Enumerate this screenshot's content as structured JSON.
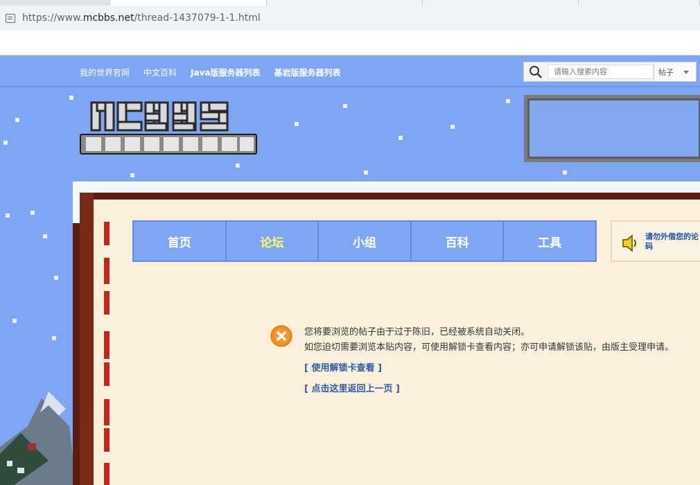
{
  "browser": {
    "url_prefix": "https://www.",
    "url_host": "mcbbs.net",
    "url_path": "/thread-1437079-1-1.html"
  },
  "topnav": {
    "links": [
      {
        "label": "我的世界官网"
      },
      {
        "label": "中文百科"
      },
      {
        "label": "Java版服务器列表"
      },
      {
        "label": "基岩版服务器列表"
      }
    ],
    "search_placeholder": "请输入搜索内容",
    "search_scope": "帖子"
  },
  "tabs": [
    {
      "label": "首页"
    },
    {
      "label": "论坛"
    },
    {
      "label": "小组"
    },
    {
      "label": "百科"
    },
    {
      "label": "工具"
    }
  ],
  "notice": {
    "text_line1": "请勿外借您的论",
    "text_line2": "码"
  },
  "message": {
    "line1": "您将要浏览的帖子由于过于陈旧，已经被系统自动关闭。",
    "line2": "如您迫切需要浏览本贴内容，可使用解锁卡查看内容；亦可申请解锁该贴，由版主受理申请。",
    "link_unlock": "[ 使用解锁卡查看 ]",
    "link_back": "[ 点击这里返回上一页 ]"
  },
  "colors": {
    "sky": "#7ea6f2",
    "tab_active": "#ffff66",
    "link": "#2e5aa8",
    "panel": "#faf0dc",
    "frame": "#5a1d10"
  }
}
